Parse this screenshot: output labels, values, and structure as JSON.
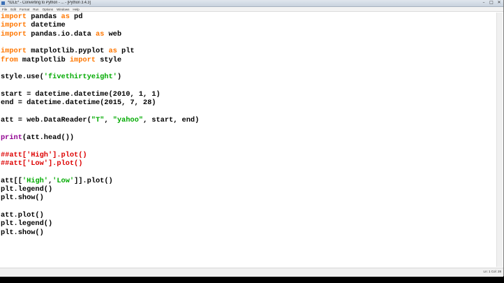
{
  "window": {
    "title": "*IDLE* - Converting to Python - ... - [Python 3.4.3]",
    "minimize": "–",
    "maximize": "□",
    "close": "✕"
  },
  "menu": [
    "File",
    "Edit",
    "Format",
    "Run",
    "Options",
    "Windows",
    "Help"
  ],
  "status": {
    "position": "Ln: 1 Col: 28"
  },
  "code_lines": [
    [
      {
        "t": "import",
        "c": "kw"
      },
      {
        "t": " pandas ",
        "c": ""
      },
      {
        "t": "as",
        "c": "kw"
      },
      {
        "t": " pd",
        "c": ""
      }
    ],
    [
      {
        "t": "import",
        "c": "kw"
      },
      {
        "t": " datetime",
        "c": ""
      }
    ],
    [
      {
        "t": "import",
        "c": "kw"
      },
      {
        "t": " pandas.io.data ",
        "c": ""
      },
      {
        "t": "as",
        "c": "kw"
      },
      {
        "t": " web",
        "c": ""
      }
    ],
    [],
    [
      {
        "t": "import",
        "c": "kw"
      },
      {
        "t": " matplotlib.pyplot ",
        "c": ""
      },
      {
        "t": "as",
        "c": "kw"
      },
      {
        "t": " plt",
        "c": ""
      }
    ],
    [
      {
        "t": "from",
        "c": "kw"
      },
      {
        "t": " matplotlib ",
        "c": ""
      },
      {
        "t": "import",
        "c": "kw"
      },
      {
        "t": " style",
        "c": ""
      }
    ],
    [],
    [
      {
        "t": "style.use(",
        "c": ""
      },
      {
        "t": "'fivethirtyeight'",
        "c": "str"
      },
      {
        "t": ")",
        "c": ""
      }
    ],
    [],
    [
      {
        "t": "start = datetime.datetime(2010, 1, 1)",
        "c": ""
      }
    ],
    [
      {
        "t": "end = datetime.datetime(2015, 7, 28)",
        "c": ""
      }
    ],
    [],
    [
      {
        "t": "att = web.DataReader(",
        "c": ""
      },
      {
        "t": "\"T\"",
        "c": "str"
      },
      {
        "t": ", ",
        "c": ""
      },
      {
        "t": "\"yahoo\"",
        "c": "str"
      },
      {
        "t": ", start, end)",
        "c": ""
      }
    ],
    [],
    [
      {
        "t": "print",
        "c": "bi"
      },
      {
        "t": "(att.head())",
        "c": ""
      }
    ],
    [],
    [
      {
        "t": "##att['High'].plot()",
        "c": "cm"
      }
    ],
    [
      {
        "t": "##att['Low'].plot()",
        "c": "cm"
      }
    ],
    [],
    [
      {
        "t": "att[[",
        "c": ""
      },
      {
        "t": "'High'",
        "c": "str"
      },
      {
        "t": ",",
        "c": ""
      },
      {
        "t": "'Low'",
        "c": "str"
      },
      {
        "t": "]].plot()",
        "c": ""
      }
    ],
    [
      {
        "t": "plt.legend()",
        "c": ""
      }
    ],
    [
      {
        "t": "plt.show()",
        "c": ""
      }
    ],
    [],
    [
      {
        "t": "att.plot()",
        "c": ""
      }
    ],
    [
      {
        "t": "plt.legend()",
        "c": ""
      }
    ],
    [
      {
        "t": "plt.show()",
        "c": ""
      }
    ]
  ]
}
